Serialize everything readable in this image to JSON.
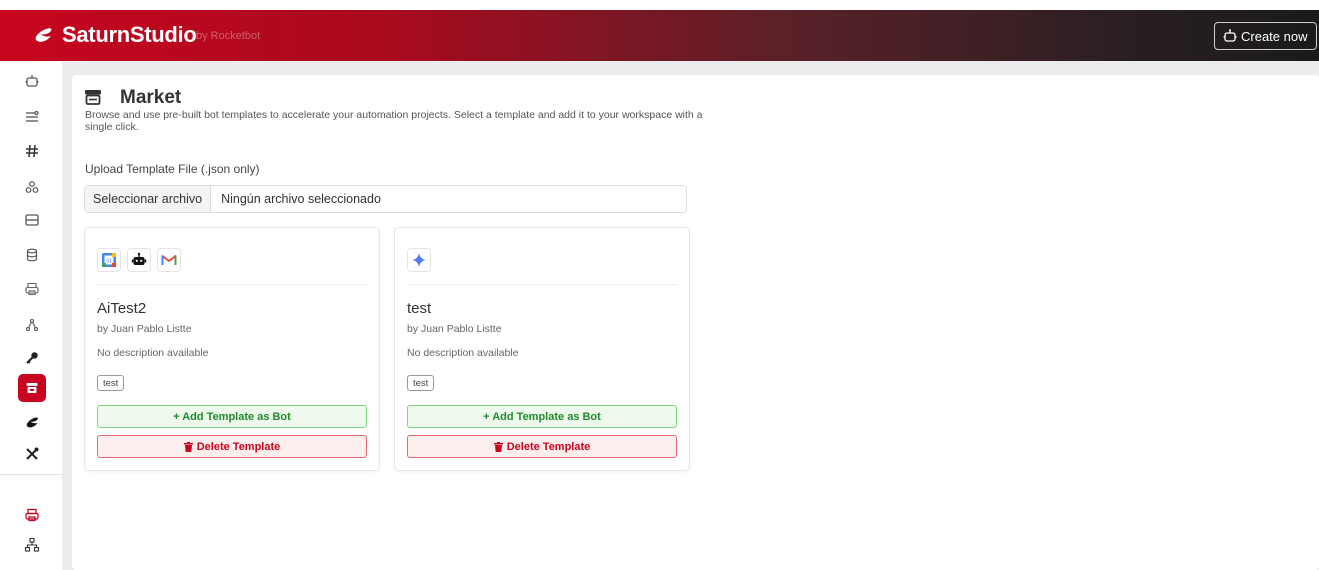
{
  "app": {
    "name": "SaturnStudio",
    "by": "by Rocketbot",
    "create_label": "Create now"
  },
  "page": {
    "title": "Market",
    "description": "Browse and use pre-built bot templates to accelerate your automation projects. Select a template and add it to your workspace with a single click.",
    "upload_label": "Upload Template File (.json only)",
    "file_button": "Seleccionar archivo",
    "file_status": "Ningún archivo seleccionado"
  },
  "sidebar": {
    "items": [
      {
        "icon": "robot-icon"
      },
      {
        "icon": "sliders-icon"
      },
      {
        "icon": "hashtag-icon"
      },
      {
        "icon": "cluster-icon"
      },
      {
        "icon": "panel-icon"
      },
      {
        "icon": "database-icon"
      },
      {
        "icon": "printer-icon"
      },
      {
        "icon": "nodes-icon"
      },
      {
        "icon": "key-icon"
      },
      {
        "icon": "store-icon",
        "active": true
      },
      {
        "icon": "saturn-icon"
      },
      {
        "icon": "tools-icon"
      },
      {
        "icon": "printer-red-icon"
      },
      {
        "icon": "sitemap-icon"
      }
    ]
  },
  "templates": [
    {
      "name": "AiTest2",
      "author": "by Juan Pablo Listte",
      "description": "No description available",
      "tag": "test",
      "icons": [
        "google-calendar-icon",
        "robot-icon",
        "gmail-icon"
      ],
      "add_label": "+ Add Template as Bot",
      "delete_label": "Delete Template"
    },
    {
      "name": "test",
      "author": "by Juan Pablo Listte",
      "description": "No description available",
      "tag": "test",
      "icons": [
        "gemini-icon"
      ],
      "add_label": "+ Add Template as Bot",
      "delete_label": "Delete Template"
    }
  ],
  "colors": {
    "brand": "#c8051f",
    "success": "#1f8a2a",
    "danger": "#c8051f"
  }
}
